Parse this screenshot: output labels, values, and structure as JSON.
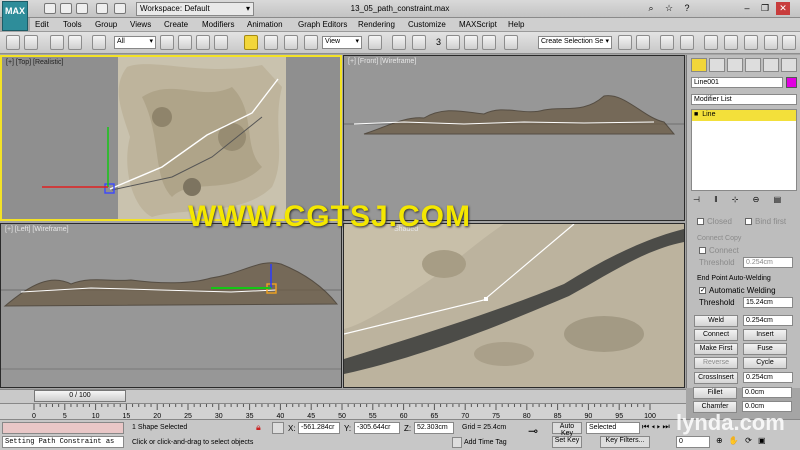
{
  "title_bar": {
    "workspace": "Workspace: Default",
    "doc_title": "13_05_path_constraint.max",
    "logo": "MAX"
  },
  "menu": [
    "Edit",
    "Tools",
    "Group",
    "Views",
    "Create",
    "Modifiers",
    "Animation",
    "Graph Editors",
    "Rendering",
    "Customize",
    "MAXScript",
    "Help"
  ],
  "toolbar": {
    "selection_filter": "All",
    "ref_coord": "View",
    "snap_value": "3",
    "named_selection": "Create Selection Se"
  },
  "viewports": {
    "top": "[+] [Top] [Realistic]",
    "front": "[+] [Front] [Wireframe]",
    "left": "[+] [Left] [Wireframe]",
    "persp": "Shaded"
  },
  "command_panel": {
    "object_name": "Line001",
    "modifier_list": "Modifier List",
    "stack_item": "Line",
    "closed": "Closed",
    "bind_first": "Bind first",
    "connect_copy": "Connect Copy",
    "connect": "Connect",
    "threshold_label": "Threshold",
    "threshold_copy": "0.254cm",
    "end_point_auto_welding": "End Point Auto-Welding",
    "automatic_welding": "Automatic Welding",
    "threshold_weld": "15.24cm",
    "weld": "Weld",
    "weld_val": "0.254cm",
    "connect_btn": "Connect",
    "insert": "Insert",
    "make_first": "Make First",
    "fuse": "Fuse",
    "reverse": "Reverse",
    "cycle": "Cycle",
    "crossinsert": "CrossInsert",
    "crossinsert_val": "0.254cm",
    "fillet": "Fillet",
    "fillet_val": "0.0cm",
    "chamfer": "Chamfer",
    "chamfer_val": "0.0cm"
  },
  "timeline": {
    "slider": "0 / 100",
    "ticks": [
      "0",
      "5",
      "10",
      "15",
      "20",
      "25",
      "30",
      "35",
      "40",
      "45",
      "50",
      "55",
      "60",
      "65",
      "70",
      "75",
      "80",
      "85",
      "90",
      "95",
      "100"
    ]
  },
  "status": {
    "selection": "1 Shape Selected",
    "prompt": "Click or click-and-drag to select objects",
    "script_line": "Setting Path Constraint as",
    "x": "-561.284cr",
    "y": "-305.644cr",
    "z": "52.303cm",
    "grid": "Grid = 25.4cm",
    "add_time_tag": "Add Time Tag",
    "auto_key": "Auto Key",
    "set_key": "Set Key",
    "key_mode": "Selected",
    "key_filters": "Key Filters...",
    "frame": "0"
  },
  "watermark": "WWW.CGTSJ.COM",
  "brand": "lynda.com"
}
